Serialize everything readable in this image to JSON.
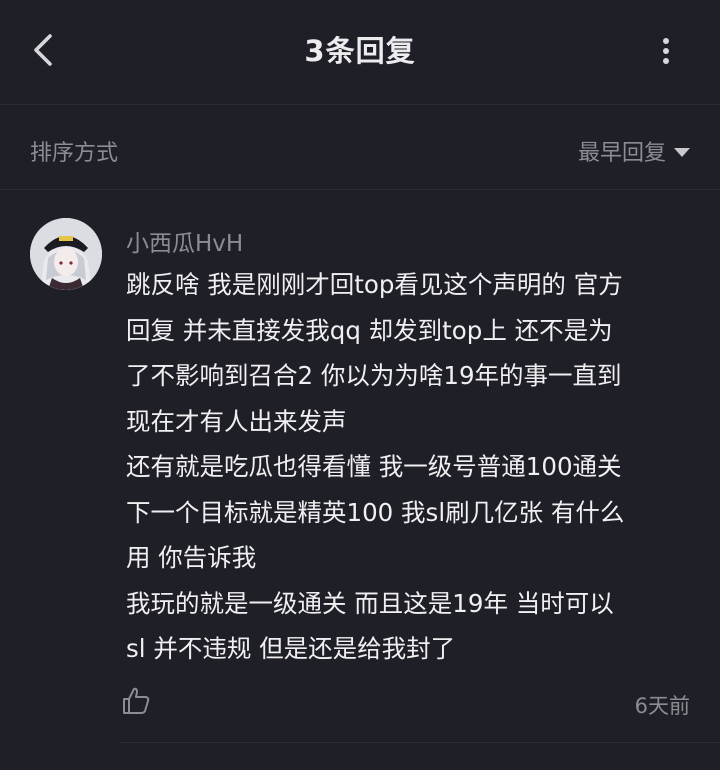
{
  "header": {
    "title": "3条回复",
    "back_icon": "chevron-left-icon",
    "more_icon": "more-vertical-icon"
  },
  "sort": {
    "label": "排序方式",
    "selected": "最早回复"
  },
  "comment": {
    "username": "小西瓜HvH",
    "lines": [
      "跳反啥 我是刚刚才回top看见这个声明的 官方",
      "回复 并未直接发我qq 却发到top上 还不是为",
      "了不影响到召合2 你以为为啥19年的事一直到",
      "现在才有人出来发声",
      "还有就是吃瓜也得看懂 我一级号普通100通关",
      "下一个目标就是精英100 我sl刷几亿张 有什么",
      "用 你告诉我",
      "我玩的就是一级通关 而且这是19年 当时可以",
      "sl 并不违规 但是还是给我封了"
    ],
    "time": "6天前",
    "like_icon": "thumbs-up-icon"
  },
  "colors": {
    "background": "#1f1f27",
    "divider": "#2c2c35",
    "muted_text": "#8c8c93",
    "primary_text": "#f0f0f2"
  }
}
